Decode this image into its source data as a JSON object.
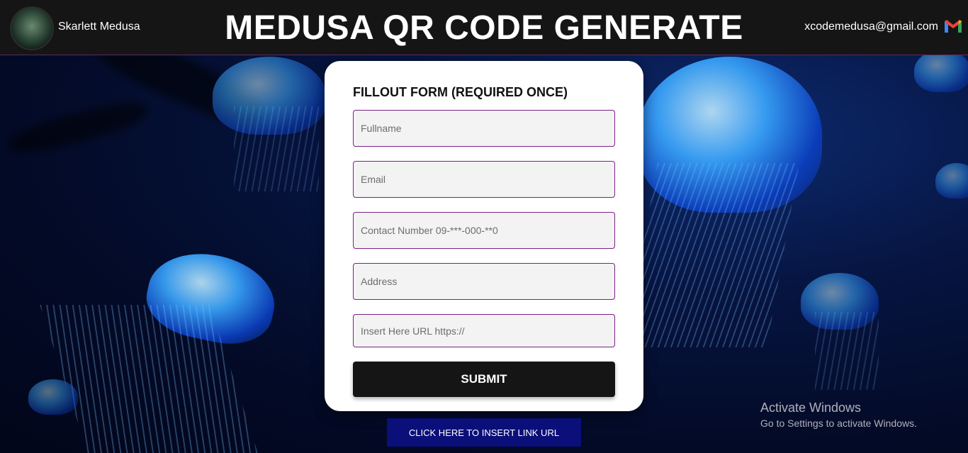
{
  "header": {
    "username": "Skarlett Medusa",
    "title": "MEDUSA QR CODE GENERATE",
    "email": "xcodemedusa@gmail.com"
  },
  "form": {
    "heading": "FILLOUT FORM (REQUIRED ONCE)",
    "fields": [
      {
        "placeholder": "Fullname",
        "value": ""
      },
      {
        "placeholder": "Email",
        "value": ""
      },
      {
        "placeholder": "Contact Number 09-***-000-**0",
        "value": ""
      },
      {
        "placeholder": "Address",
        "value": ""
      },
      {
        "placeholder": "Insert Here URL https://",
        "value": ""
      }
    ],
    "submit_label": "SUBMIT"
  },
  "link_button": "CLICK HERE TO INSERT LINK URL",
  "watermark": {
    "line1": "Activate Windows",
    "line2": "Go to Settings to activate Windows."
  },
  "colors": {
    "header_bg": "#151515",
    "field_border": "#7b1f86",
    "submit_bg": "#151515",
    "link_button_bg": "#0a0f7a"
  },
  "icons": {
    "gmail": "gmail-icon",
    "avatar": "medusa-avatar"
  }
}
